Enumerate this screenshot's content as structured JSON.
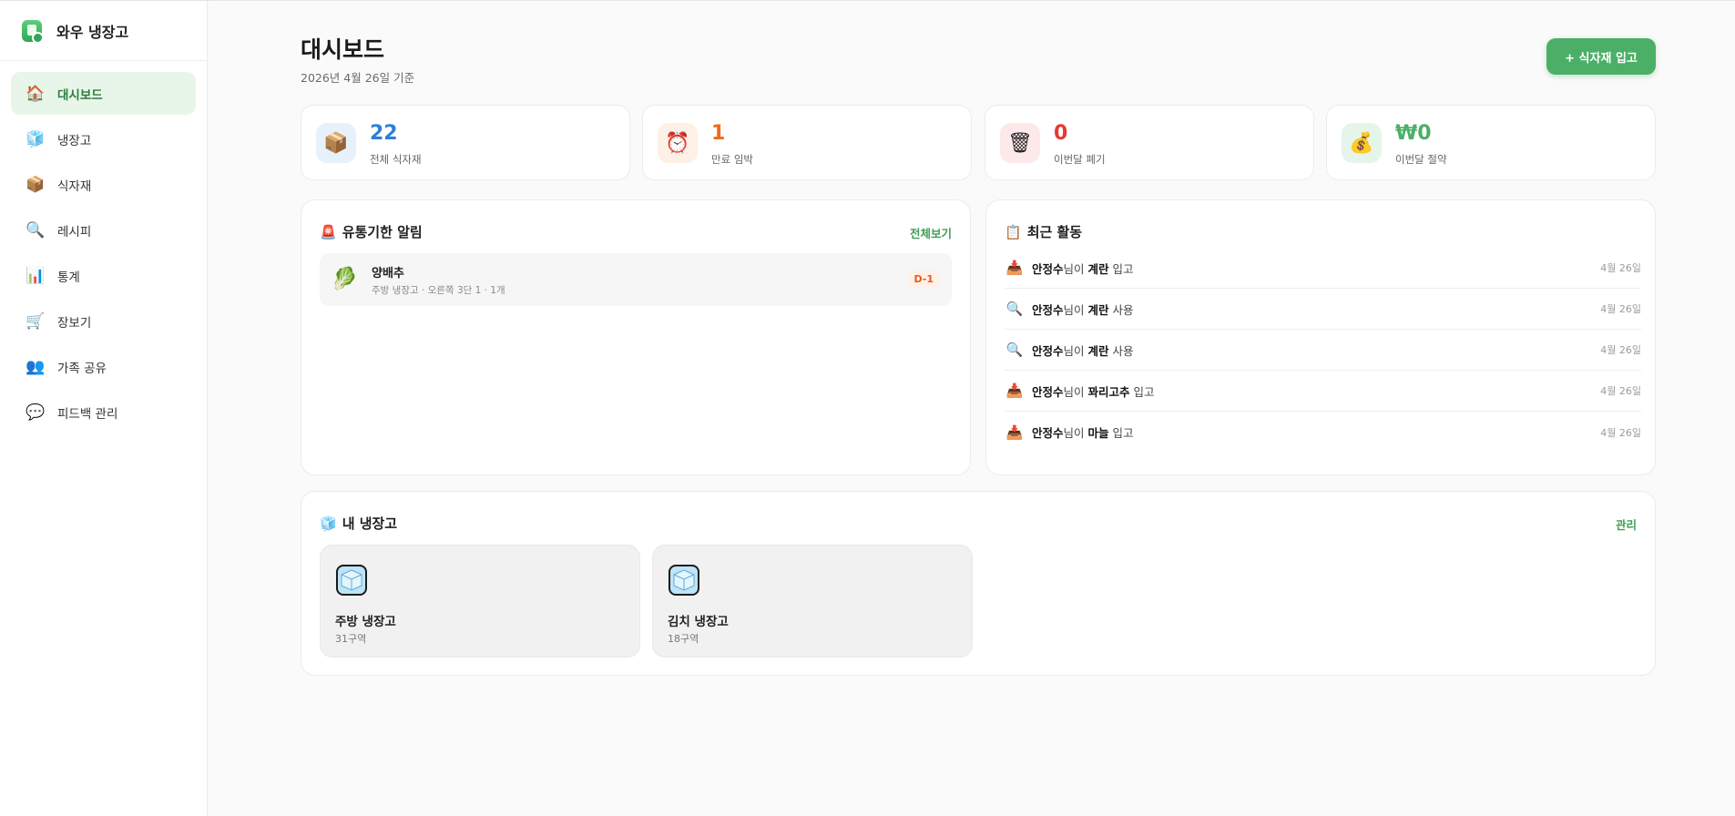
{
  "app": {
    "name": "와우 냉장고"
  },
  "sidebar": {
    "items": [
      {
        "label": "대시보드",
        "icon": "home-icon",
        "glyph": "🏠",
        "active": true
      },
      {
        "label": "냉장고",
        "icon": "ice-cube-icon",
        "glyph": "🧊"
      },
      {
        "label": "식자재",
        "icon": "box-icon",
        "glyph": "📦"
      },
      {
        "label": "레시피",
        "icon": "magnifier-icon",
        "glyph": "🔍"
      },
      {
        "label": "통계",
        "icon": "bar-chart-icon",
        "glyph": "📊"
      },
      {
        "label": "장보기",
        "icon": "cart-icon",
        "glyph": "🛒"
      },
      {
        "label": "가족 공유",
        "icon": "people-icon",
        "glyph": "👥"
      },
      {
        "label": "피드백 관리",
        "icon": "speech-bubble-icon",
        "glyph": "💬"
      }
    ]
  },
  "header": {
    "title": "대시보드",
    "subtitle": "2026년 4월 26일 기준",
    "add_button": "+ 식자재 입고"
  },
  "stats": [
    {
      "value": "22",
      "label": "전체 식자재",
      "glyph": "📦",
      "icon": "box-icon",
      "color": "#2f7fd8",
      "bg": "#e7f1fc"
    },
    {
      "value": "1",
      "label": "만료 임박",
      "glyph": "⏰",
      "icon": "alarm-clock-icon",
      "color": "#f06a1c",
      "bg": "#fdf0e4"
    },
    {
      "value": "0",
      "label": "이번달 폐기",
      "glyph": "🗑",
      "icon": "trash-icon",
      "color": "#e5392f",
      "bg": "#fde9ea"
    },
    {
      "value": "₩0",
      "label": "이번달 절약",
      "glyph": "💰",
      "icon": "money-bag-icon",
      "color": "#4caf68",
      "bg": "#e6f5ea"
    }
  ],
  "expiry_panel": {
    "title": "유통기한 알림",
    "title_glyph": "🚨",
    "link": "전체보기",
    "items": [
      {
        "name": "양배추",
        "meta": "주방 냉장고 · 오른쪽 3단 1 · 1개",
        "badge": "D-1",
        "glyph": "🥬"
      }
    ]
  },
  "activity_panel": {
    "title": "최근 활동",
    "title_glyph": "📋",
    "rows": [
      {
        "user": "안정수",
        "mid": "님이 ",
        "item": "계란",
        "action": " 입고",
        "date": "4월 26일",
        "glyph": "📥",
        "icon": "inbox-icon"
      },
      {
        "user": "안정수",
        "mid": "님이 ",
        "item": "계란",
        "action": " 사용",
        "date": "4월 26일",
        "glyph": "🔍",
        "icon": "magnifier-icon"
      },
      {
        "user": "안정수",
        "mid": "님이 ",
        "item": "계란",
        "action": " 사용",
        "date": "4월 26일",
        "glyph": "🔍",
        "icon": "magnifier-icon"
      },
      {
        "user": "안정수",
        "mid": "님이 ",
        "item": "꽈리고추",
        "action": " 입고",
        "date": "4월 26일",
        "glyph": "📥",
        "icon": "inbox-icon"
      },
      {
        "user": "안정수",
        "mid": "님이 ",
        "item": "마늘",
        "action": " 입고",
        "date": "4월 26일",
        "glyph": "📥",
        "icon": "inbox-icon"
      }
    ]
  },
  "fridge_panel": {
    "title": "내 냉장고",
    "title_glyph": "🧊",
    "link": "관리",
    "fridges": [
      {
        "name": "주방 냉장고",
        "zones": "31구역"
      },
      {
        "name": "김치 냉장고",
        "zones": "18구역"
      }
    ]
  }
}
